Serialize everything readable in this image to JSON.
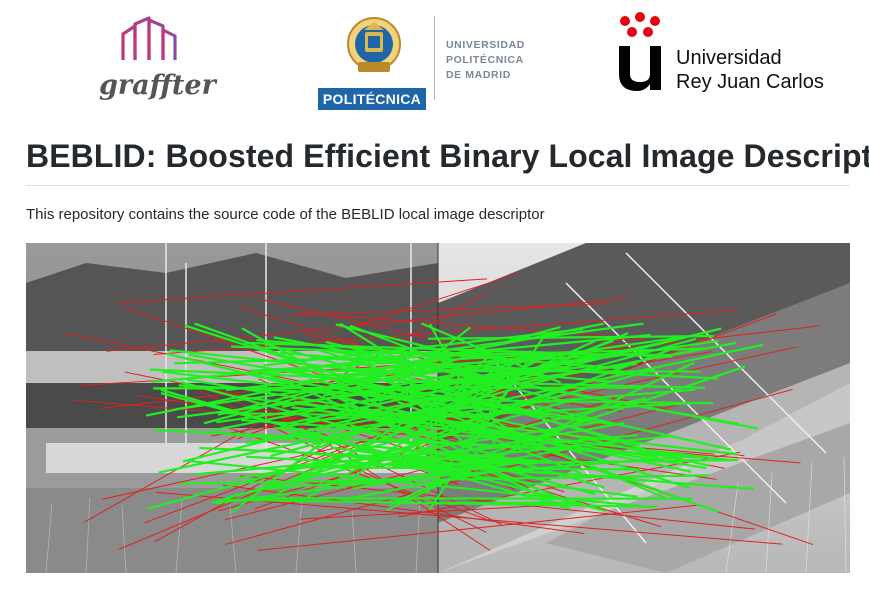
{
  "logos": {
    "graffter": {
      "wordmark": "graffter"
    },
    "upm": {
      "band": "POLITÉCNICA",
      "lines": [
        "UNIVERSIDAD",
        "POLITÉCNICA",
        "DE MADRID"
      ]
    },
    "urjc": {
      "lines": [
        "Universidad",
        "Rey Juan Carlos"
      ]
    }
  },
  "page": {
    "title": "BEBLID: Boosted Efficient Binary Local Image Descriptor",
    "description": "This repository contains the source code of the BEBLID local image descriptor"
  },
  "colors": {
    "inlier_match": "#22ee22",
    "outlier_match": "#e02020",
    "upm_blue": "#1f66a8",
    "urjc_red": "#e30613",
    "graffter_pink": "#c0357a"
  },
  "figure": {
    "left_icon": "harbor-boats-photo",
    "right_icon": "harbor-boats-photo-rotated"
  }
}
